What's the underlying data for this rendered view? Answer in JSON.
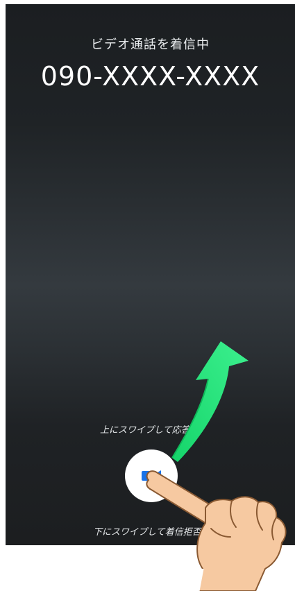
{
  "call": {
    "incoming_label": "ビデオ通話を着信中",
    "caller_number": "090-XXXX-XXXX"
  },
  "hints": {
    "swipe_up": "上にスワイプして応答",
    "swipe_down": "下にスワイプして着信拒否"
  },
  "answer_button": {
    "icon": "video-camera-icon",
    "icon_color": "#1a73e8"
  },
  "overlay": {
    "arrow_color": "#22e27a",
    "hand": "pointing-hand"
  }
}
